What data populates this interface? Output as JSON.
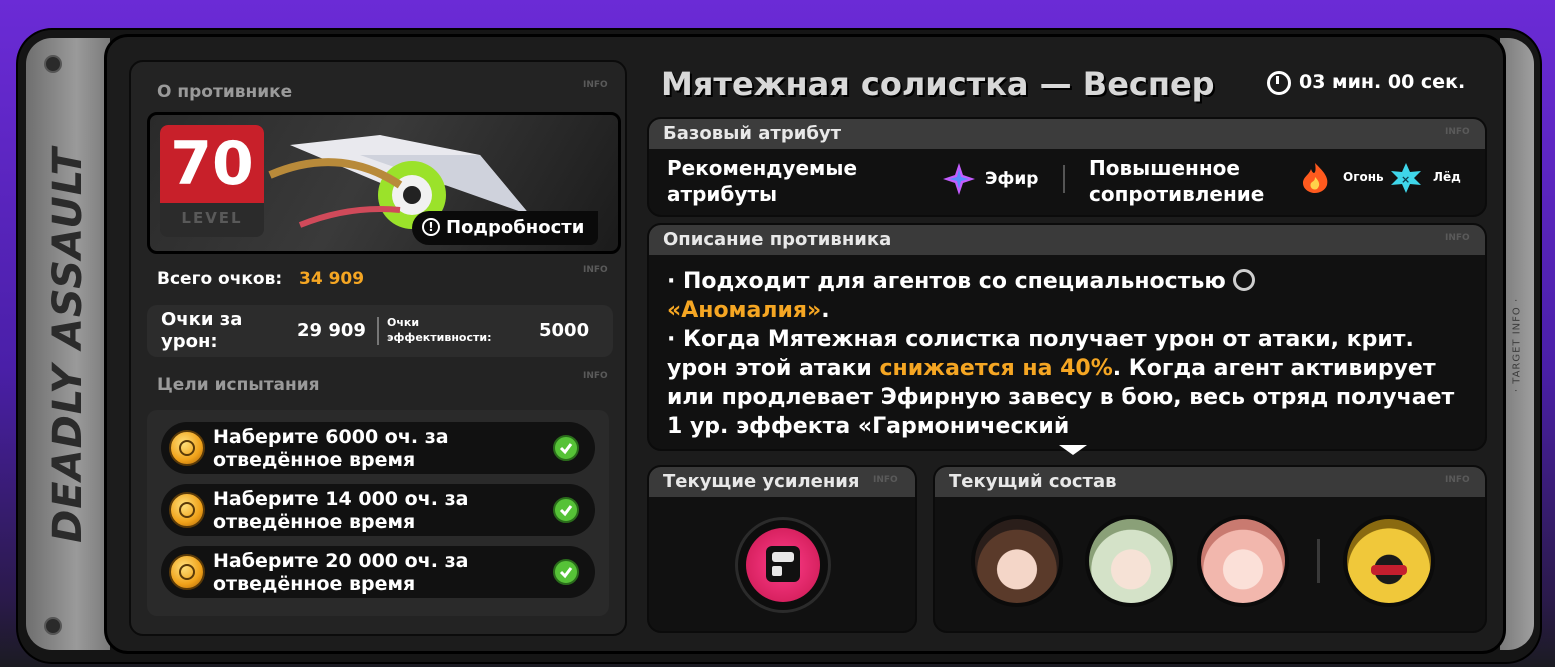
{
  "side": {
    "vertical_title": "DEADLY ASSAULT",
    "vertical_info": "· TARGET INFO ·"
  },
  "enemy_panel": {
    "header": "О противнике",
    "info_tag": "INFO",
    "level_number": "70",
    "level_label": "LEVEL",
    "details_button": "Подробности",
    "total_label": "Всего очков:",
    "total_value": "34 909",
    "damage_label": "Очки за урон:",
    "damage_value": "29 909",
    "efficiency_label": "Очки эффективности:",
    "efficiency_value": "5000",
    "goals_header": "Цели испытания",
    "goals": [
      {
        "text": "Наберите 6000 оч. за отведённое время"
      },
      {
        "text": "Наберите 14 000 оч. за отведённое время"
      },
      {
        "text": "Наберите 20 000 оч. за отведённое время"
      }
    ]
  },
  "boss": {
    "name": "Мятежная солистка — Веспер",
    "timer": "03 мин. 00 сек."
  },
  "base_attribute": {
    "header": "Базовый атрибут",
    "recommended_label": "Рекомендуемые атрибуты",
    "recommended": [
      {
        "name": "Эфир",
        "icon": "ether-icon"
      }
    ],
    "resist_label": "Повышенное сопротивление",
    "resist": [
      {
        "name": "Огонь",
        "icon": "fire-icon"
      },
      {
        "name": "Лёд",
        "icon": "ice-icon"
      }
    ]
  },
  "description": {
    "header": "Описание противника",
    "line1_pre": "· Подходит для агентов со специальностью",
    "line1_hl": "«Аномалия»",
    "line1_post": ".",
    "line2_pre": "· Когда Мятежная солистка получает урон от атаки, крит. урон этой атаки",
    "line2_hl": "снижается на 40%",
    "line2_post": ". Когда агент активирует или продлевает Эфирную завесу в бою, весь отряд получает 1 ур. эффекта «Гармонический"
  },
  "buffs": {
    "header": "Текущие усиления",
    "icon": "fist-buff-icon"
  },
  "team": {
    "header": "Текущий состав",
    "members": [
      "agent-portrait-1",
      "agent-portrait-2",
      "agent-portrait-3",
      "bangboo-portrait"
    ]
  },
  "colors": {
    "accent": "#f5a623",
    "level_red": "#c8202a",
    "check_green": "#56c237"
  }
}
